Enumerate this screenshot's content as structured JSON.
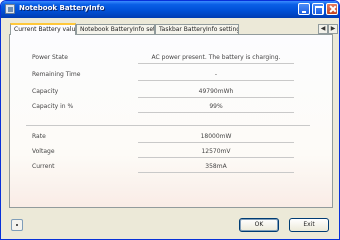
{
  "window": {
    "title": "Notebook BatteryInfo",
    "controls": {
      "minimize": "minimize-icon",
      "maximize": "maximize-icon",
      "close": "close-icon"
    }
  },
  "tabs": [
    {
      "label": "Current Battery values",
      "active": true
    },
    {
      "label": "Notebook BatteryInfo setup",
      "active": false
    },
    {
      "label": "Taskbar BatteryInfo settings",
      "active": false
    }
  ],
  "tab_scroll": {
    "left": "◀",
    "right": "▶"
  },
  "battery": {
    "power_state": {
      "label": "Power State",
      "value": "AC power present. The battery is charging."
    },
    "remaining_time": {
      "label": "Remaining Time",
      "value": "-"
    },
    "capacity": {
      "label": "Capacity",
      "value": "49790mWh"
    },
    "capacity_pct": {
      "label": "Capacity in %",
      "value": "99%"
    },
    "rate": {
      "label": "Rate",
      "value": "18000mW"
    },
    "voltage": {
      "label": "Voltage",
      "value": "12570mV"
    },
    "current": {
      "label": "Current",
      "value": "358mA"
    }
  },
  "buttons": {
    "ok": "OK",
    "exit": "Exit"
  },
  "colors": {
    "titlebar": "#0050d8",
    "window_bg": "#ece9d8",
    "active_tab_accent": "#ffc83c"
  }
}
